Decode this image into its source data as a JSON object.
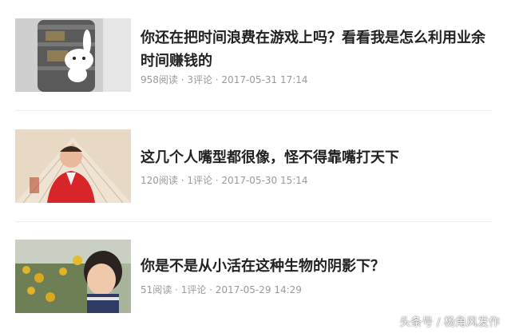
{
  "articles": [
    {
      "title": "你还在把时间浪费在游戏上吗？看看我是怎么利用业余时间赚钱的",
      "meta": "958阅读 · 3评论 · 2017-05-31 17:14",
      "thumbnail": "cartoon-rabbit-on-tin-can"
    },
    {
      "title": "这几个人嘴型都很像，怪不得靠嘴打天下",
      "meta": "120阅读 · 1评论 · 2017-05-30 15:14",
      "thumbnail": "man-in-red-jacket-with-fan"
    },
    {
      "title": "你是不是从小活在这种生物的阴影下？",
      "meta": "51阅读 · 1评论 · 2017-05-29 14:29",
      "thumbnail": "child-in-sunflower-field"
    }
  ],
  "watermark": "头条号 / 杨角风发作"
}
